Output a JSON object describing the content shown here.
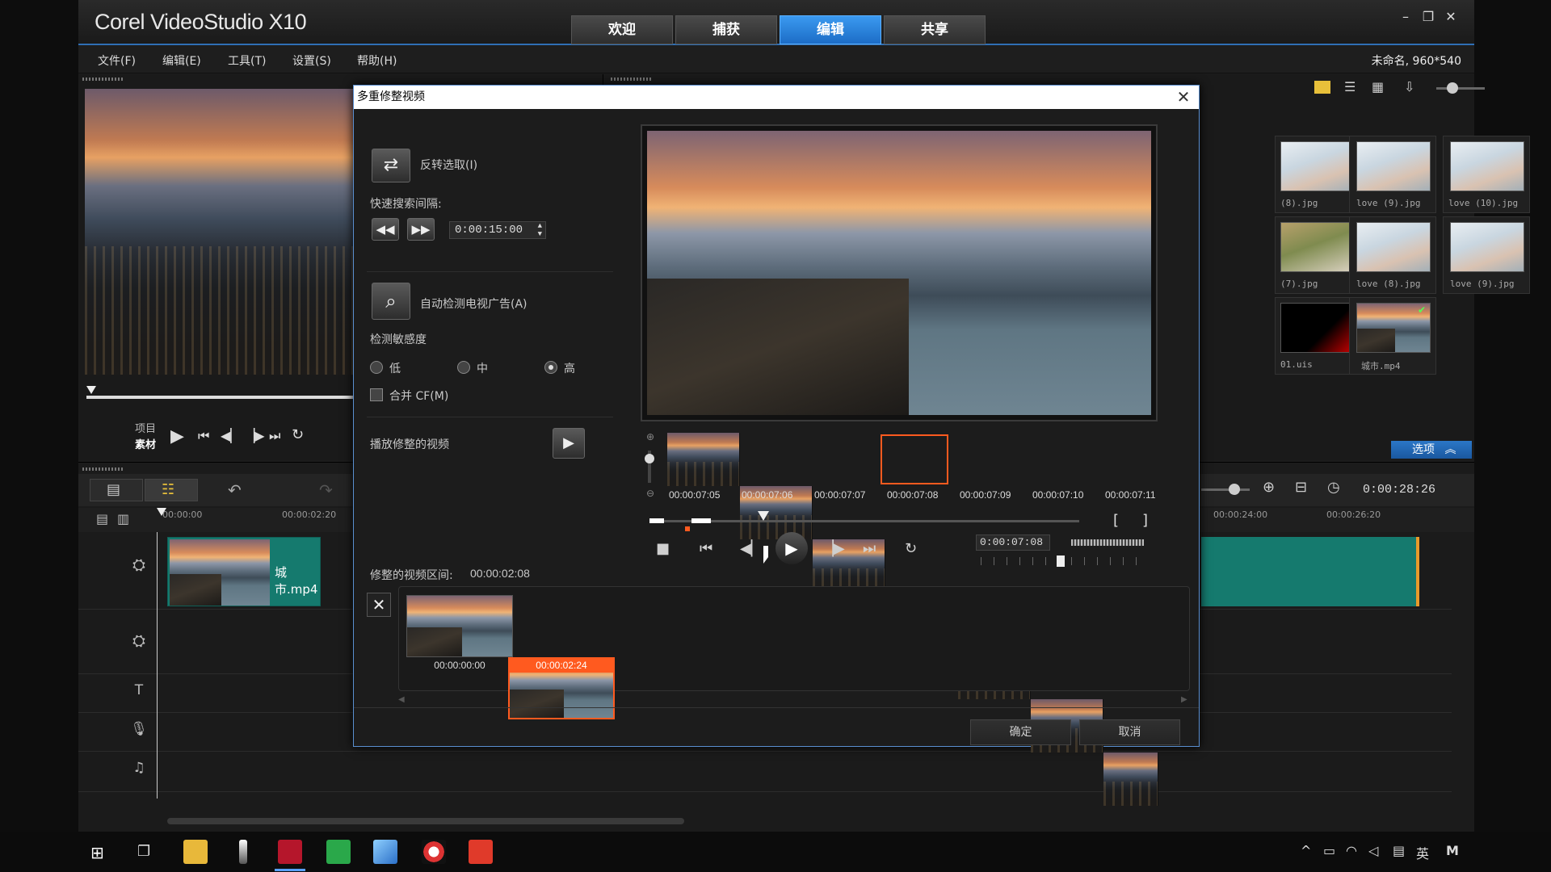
{
  "app": {
    "brand": "Corel VideoStudio X10",
    "tabs": [
      {
        "label": "欢迎"
      },
      {
        "label": "捕获"
      },
      {
        "label": "编辑"
      },
      {
        "label": "共享"
      }
    ],
    "active_tab": "编辑",
    "menu": [
      "文件(F)",
      "编辑(E)",
      "工具(T)",
      "设置(S)",
      "帮助(H)"
    ],
    "project_info": "未命名, 960*540"
  },
  "player": {
    "mode_project": "项目",
    "mode_clip": "素材"
  },
  "library": {
    "items": [
      {
        "label": "(8).jpg"
      },
      {
        "label": "love (9).jpg"
      },
      {
        "label": "love (10).jpg"
      },
      {
        "label": "(7).jpg"
      },
      {
        "label": "love (8).jpg"
      },
      {
        "label": "love (9).jpg"
      },
      {
        "label": "01.uis"
      },
      {
        "label": "城市.mp4"
      }
    ],
    "options_label": "选项"
  },
  "timeline": {
    "ruler": [
      "00:00:00",
      "00:00:02:20",
      "00:00:24:00",
      "00:00:26:20"
    ],
    "timecode": "0:00:28:26",
    "clip_label": "城市.mp4"
  },
  "dialog": {
    "title": "多重修整视频",
    "invert_selection": "反转选取(I)",
    "quick_search_label": "快速搜索间隔:",
    "quick_search_value": "0:00:15:00",
    "auto_detect": "自动检测电视广告(A)",
    "sensitivity_label": "检测敏感度",
    "sensitivity_options": [
      {
        "label": "低",
        "checked": false
      },
      {
        "label": "中",
        "checked": false
      },
      {
        "label": "高",
        "checked": true
      }
    ],
    "merge_cf": "合并 CF(M)",
    "play_trimmed": "播放修整的视频",
    "trimmed_duration_label": "修整的视频区间:",
    "trimmed_duration_value": "00:00:02:08",
    "strip_times": [
      "00:00:07:05",
      "00:00:07:06",
      "00:00:07:07",
      "00:00:07:08",
      "00:00:07:09",
      "00:00:07:10",
      "00:00:07:11"
    ],
    "current_timecode": "0:00:07:08",
    "mark_in": "[",
    "mark_out": "]",
    "clips": [
      {
        "time": "00:00:00:00",
        "selected": false
      },
      {
        "time": "00:00:02:24",
        "selected": true
      }
    ],
    "ok_label": "确定",
    "cancel_label": "取消"
  },
  "taskbar": {
    "lang": "英",
    "ime": "M"
  },
  "colors": {
    "accent": "#1c6cc6",
    "selection": "#ff5a1f",
    "clip_track": "#157a6e"
  }
}
